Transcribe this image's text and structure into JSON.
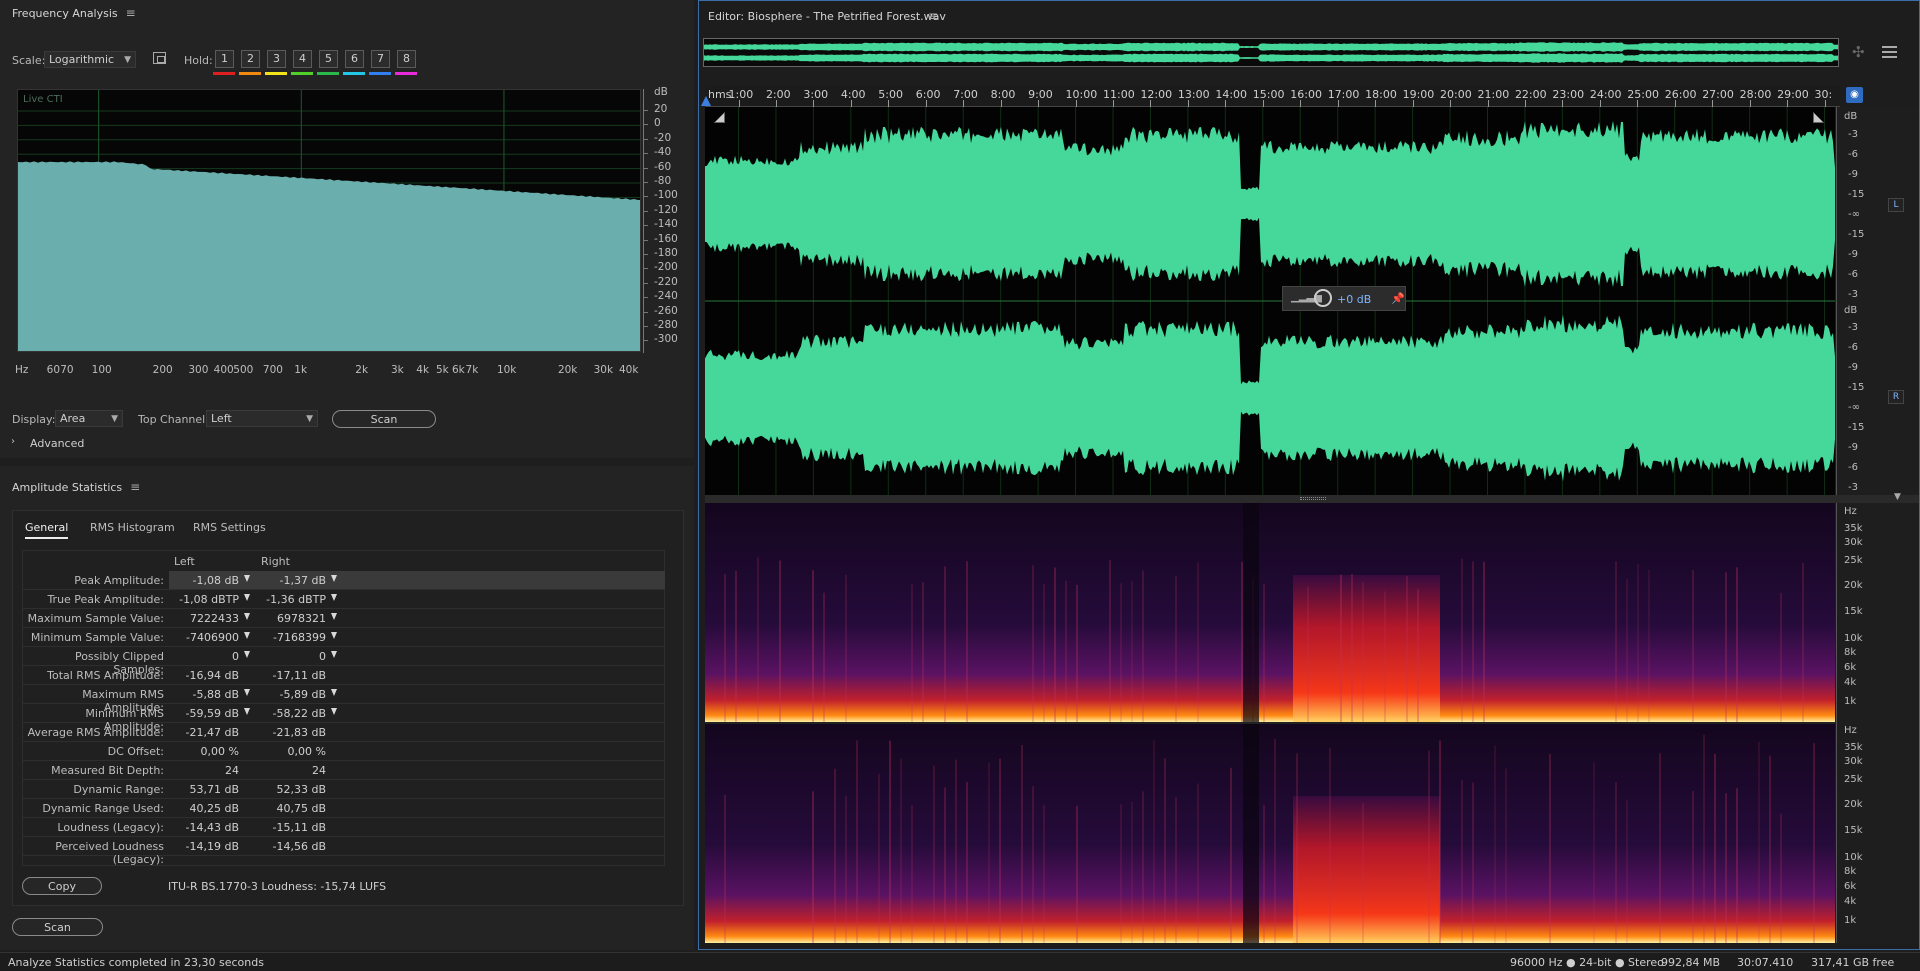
{
  "frequency_panel": {
    "title": "Frequency Analysis",
    "scale_label": "Scale:",
    "scale_value": "Logarithmic",
    "hold_label": "Hold:",
    "hold_buttons": [
      "1",
      "2",
      "3",
      "4",
      "5",
      "6",
      "7",
      "8"
    ],
    "hold_colors": [
      "#e02020",
      "#f08a10",
      "#f2e41a",
      "#4fd12a",
      "#2ab84a",
      "#22c7e8",
      "#2f7ff0",
      "#e82ad8"
    ],
    "overlay_label": "Live CTI",
    "db_unit": "dB",
    "y_ticks": [
      "20",
      "0",
      "-20",
      "-40",
      "-60",
      "-80",
      "-100",
      "-120",
      "-140",
      "-160",
      "-180",
      "-200",
      "-220",
      "-240",
      "-260",
      "-280",
      "-300"
    ],
    "x_unit": "Hz",
    "x_ticks": [
      "60",
      "70",
      "100",
      "200",
      "300",
      "400",
      "500",
      "700",
      "1k",
      "2k",
      "3k",
      "4k",
      "5k",
      "6k",
      "7k",
      "10k",
      "20k",
      "30k",
      "40k"
    ],
    "display_label": "Display:",
    "display_value": "Area",
    "top_channel_label": "Top Channel:",
    "top_channel_value": "Left",
    "scan_label": "Scan",
    "advanced_label": "Advanced",
    "fill_color": "#6aaeae"
  },
  "amplitude_panel": {
    "title": "Amplitude Statistics",
    "tabs": [
      "General",
      "RMS Histogram",
      "RMS Settings"
    ],
    "col_left": "Left",
    "col_right": "Right",
    "rows": [
      {
        "label": "Peak Amplitude:",
        "left": "-1,08 dB",
        "right": "-1,37 dB",
        "marker": true
      },
      {
        "label": "True Peak Amplitude:",
        "left": "-1,08 dBTP",
        "right": "-1,36 dBTP",
        "marker": true
      },
      {
        "label": "Maximum Sample Value:",
        "left": "7222433",
        "right": "6978321",
        "marker": true
      },
      {
        "label": "Minimum Sample Value:",
        "left": "-7406900",
        "right": "-7168399",
        "marker": true
      },
      {
        "label": "Possibly Clipped Samples:",
        "left": "0",
        "right": "0",
        "marker": true
      },
      {
        "label": "Total RMS Amplitude:",
        "left": "-16,94 dB",
        "right": "-17,11 dB",
        "marker": false
      },
      {
        "label": "Maximum RMS Amplitude:",
        "left": "-5,88 dB",
        "right": "-5,89 dB",
        "marker": true
      },
      {
        "label": "Minimum RMS Amplitude:",
        "left": "-59,59 dB",
        "right": "-58,22 dB",
        "marker": true
      },
      {
        "label": "Average RMS Amplitude:",
        "left": "-21,47 dB",
        "right": "-21,83 dB",
        "marker": false
      },
      {
        "label": "DC Offset:",
        "left": "0,00 %",
        "right": "0,00 %",
        "marker": false
      },
      {
        "label": "Measured Bit Depth:",
        "left": "24",
        "right": "24",
        "marker": false
      },
      {
        "label": "Dynamic Range:",
        "left": "53,71 dB",
        "right": "52,33 dB",
        "marker": false
      },
      {
        "label": "Dynamic Range Used:",
        "left": "40,25 dB",
        "right": "40,75 dB",
        "marker": false
      },
      {
        "label": "Loudness (Legacy):",
        "left": "-14,43 dB",
        "right": "-15,11 dB",
        "marker": false
      },
      {
        "label": "Perceived Loudness (Legacy):",
        "left": "-14,19 dB",
        "right": "-14,56 dB",
        "marker": false
      }
    ],
    "copy_label": "Copy",
    "loudness_text": "ITU-R BS.1770-3 Loudness: -15,74 LUFS",
    "scan_label": "Scan"
  },
  "editor": {
    "title": "Editor: Biosphere - The Petrified Forest.wav",
    "time_unit": "hms",
    "time_ticks": [
      "1:00",
      "2:00",
      "3:00",
      "4:00",
      "5:00",
      "6:00",
      "7:00",
      "8:00",
      "9:00",
      "10:00",
      "11:00",
      "12:00",
      "13:00",
      "14:00",
      "15:00",
      "16:00",
      "17:00",
      "18:00",
      "19:00",
      "20:00",
      "21:00",
      "22:00",
      "23:00",
      "24:00",
      "25:00",
      "26:00",
      "27:00",
      "28:00",
      "29:00",
      "30:"
    ],
    "amp_unit": "dB",
    "amp_ticks": [
      "-3",
      "-6",
      "-9",
      "-15",
      "-∞",
      "-15",
      "-9",
      "-6",
      "-3"
    ],
    "channel_left": "L",
    "channel_right": "R",
    "hud_gain": "+0 dB",
    "hz_unit": "Hz",
    "freq_ticks": [
      "35k",
      "30k",
      "25k",
      "20k",
      "15k",
      "10k",
      "8k",
      "6k",
      "4k",
      "1k"
    ],
    "wave_color": "#46d89a"
  },
  "status_bar": {
    "message": "Analyze Statistics completed in 23,30 seconds",
    "format": "96000 Hz ● 24-bit ● Stereo",
    "size": "992,84 MB",
    "duration": "30:07.410",
    "free": "317,41 GB free"
  }
}
